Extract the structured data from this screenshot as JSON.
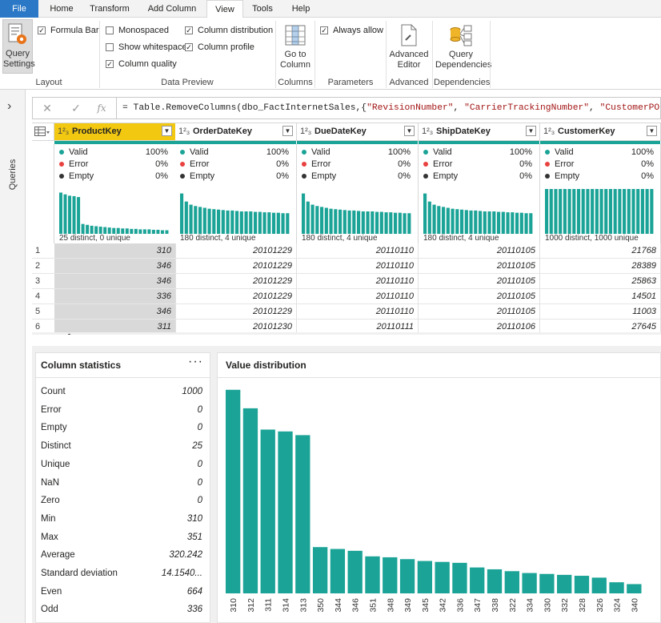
{
  "tabs": [
    "File",
    "Home",
    "Transform",
    "Add Column",
    "View",
    "Tools",
    "Help"
  ],
  "active_tab": "View",
  "ribbon": {
    "query_settings": "Query Settings",
    "formula_bar": "Formula Bar",
    "layout_label": "Layout",
    "monospaced": "Monospaced",
    "show_whitespace": "Show whitespace",
    "column_quality": "Column quality",
    "column_distribution": "Column distribution",
    "column_profile": "Column profile",
    "data_preview_label": "Data Preview",
    "go_to_column": "Go to Column",
    "columns_label": "Columns",
    "always_allow": "Always allow",
    "parameters_label": "Parameters",
    "advanced_editor": "Advanced Editor",
    "advanced_label": "Advanced",
    "query_dependencies": "Query Dependencies",
    "dependencies_label": "Dependencies",
    "checks": {
      "formula_bar": true,
      "monospaced": false,
      "show_whitespace": false,
      "column_quality": true,
      "column_distribution": true,
      "column_profile": true,
      "always_allow": true
    }
  },
  "rail": {
    "queries": "Queries",
    "expand": "›"
  },
  "formula_bar": {
    "cancel": "✕",
    "confirm": "✓",
    "fx": "fx",
    "prefix": "= Table.RemoveColumns(dbo_FactInternetSales,{",
    "s1": "\"RevisionNumber\"",
    "s2": "\"CarrierTrackingNumber\"",
    "s3": "\"CustomerPONumber\"",
    "suffix": "}"
  },
  "quality_labels": {
    "valid": "Valid",
    "error": "Error",
    "empty": "Empty"
  },
  "columns": [
    {
      "type": "1²₃",
      "name": "ProductKey",
      "valid": "100%",
      "error": "0%",
      "empty": "0%",
      "caption": "25 distinct, 0 unique",
      "spark": [
        0.92,
        0.88,
        0.85,
        0.84,
        0.82,
        0.22,
        0.2,
        0.18,
        0.17,
        0.16,
        0.15,
        0.14,
        0.13,
        0.13,
        0.12,
        0.12,
        0.11,
        0.11,
        0.1,
        0.1,
        0.1,
        0.09,
        0.09,
        0.08,
        0.08
      ]
    },
    {
      "type": "1²₃",
      "name": "OrderDateKey",
      "valid": "100%",
      "error": "0%",
      "empty": "0%",
      "caption": "180 distinct, 4 unique",
      "spark": [
        0.9,
        0.72,
        0.65,
        0.62,
        0.6,
        0.58,
        0.56,
        0.55,
        0.54,
        0.53,
        0.52,
        0.52,
        0.51,
        0.5,
        0.5,
        0.5,
        0.49,
        0.49,
        0.48,
        0.48,
        0.47,
        0.47,
        0.46,
        0.46
      ]
    },
    {
      "type": "1²₃",
      "name": "DueDateKey",
      "valid": "100%",
      "error": "0%",
      "empty": "0%",
      "caption": "180 distinct, 4 unique",
      "spark": [
        0.9,
        0.72,
        0.65,
        0.62,
        0.6,
        0.58,
        0.56,
        0.55,
        0.54,
        0.53,
        0.52,
        0.52,
        0.51,
        0.5,
        0.5,
        0.5,
        0.49,
        0.49,
        0.48,
        0.48,
        0.47,
        0.47,
        0.46,
        0.46
      ]
    },
    {
      "type": "1²₃",
      "name": "ShipDateKey",
      "valid": "100%",
      "error": "0%",
      "empty": "0%",
      "caption": "180 distinct, 4 unique",
      "spark": [
        0.9,
        0.72,
        0.65,
        0.62,
        0.6,
        0.58,
        0.56,
        0.55,
        0.54,
        0.53,
        0.52,
        0.52,
        0.51,
        0.5,
        0.5,
        0.5,
        0.49,
        0.49,
        0.48,
        0.48,
        0.47,
        0.47,
        0.46,
        0.46
      ]
    },
    {
      "type": "1²₃",
      "name": "CustomerKey",
      "valid": "100%",
      "error": "0%",
      "empty": "0%",
      "caption": "1000 distinct, 1000 unique",
      "spark": [
        1,
        1,
        1,
        1,
        1,
        1,
        1,
        1,
        1,
        1,
        1,
        1,
        1,
        1,
        1,
        1,
        1,
        1,
        1,
        1,
        1,
        1,
        1,
        1
      ]
    }
  ],
  "rows": [
    {
      "n": "1",
      "cells": [
        "310",
        "20101229",
        "20110110",
        "20110105",
        "21768"
      ]
    },
    {
      "n": "2",
      "cells": [
        "346",
        "20101229",
        "20110110",
        "20110105",
        "28389"
      ]
    },
    {
      "n": "3",
      "cells": [
        "346",
        "20101229",
        "20110110",
        "20110105",
        "25863"
      ]
    },
    {
      "n": "4",
      "cells": [
        "336",
        "20101229",
        "20110110",
        "20110105",
        "14501"
      ]
    },
    {
      "n": "5",
      "cells": [
        "346",
        "20101229",
        "20110110",
        "20110105",
        "11003"
      ]
    },
    {
      "n": "6",
      "cells": [
        "311",
        "20101230",
        "20110111",
        "20110106",
        "27645"
      ]
    }
  ],
  "column_statistics": {
    "title": "Column statistics",
    "more": "···",
    "rows": [
      {
        "label": "Count",
        "value": "1000"
      },
      {
        "label": "Error",
        "value": "0"
      },
      {
        "label": "Empty",
        "value": "0"
      },
      {
        "label": "Distinct",
        "value": "25"
      },
      {
        "label": "Unique",
        "value": "0"
      },
      {
        "label": "NaN",
        "value": "0"
      },
      {
        "label": "Zero",
        "value": "0"
      },
      {
        "label": "Min",
        "value": "310"
      },
      {
        "label": "Max",
        "value": "351"
      },
      {
        "label": "Average",
        "value": "320.242"
      },
      {
        "label": "Standard deviation",
        "value": "14.1540..."
      },
      {
        "label": "Even",
        "value": "664"
      },
      {
        "label": "Odd",
        "value": "336"
      }
    ]
  },
  "value_distribution_title": "Value distribution",
  "colors": {
    "teal": "#1aa396",
    "error_red": "#e8413f",
    "empty_dark": "#333333",
    "selected_header": "#f2c811",
    "file_tab": "#2b78c6"
  },
  "chart_data": {
    "type": "bar",
    "categories": [
      "310",
      "312",
      "311",
      "314",
      "313",
      "350",
      "344",
      "346",
      "351",
      "348",
      "349",
      "345",
      "342",
      "336",
      "347",
      "338",
      "322",
      "334",
      "330",
      "332",
      "328",
      "326",
      "324",
      "340"
    ],
    "values": [
      220,
      200,
      177,
      175,
      171,
      50,
      48,
      46,
      40,
      39,
      37,
      35,
      34,
      33,
      28,
      26,
      24,
      22,
      21,
      20,
      19,
      17,
      12,
      10
    ],
    "ylim": [
      0,
      225
    ]
  }
}
